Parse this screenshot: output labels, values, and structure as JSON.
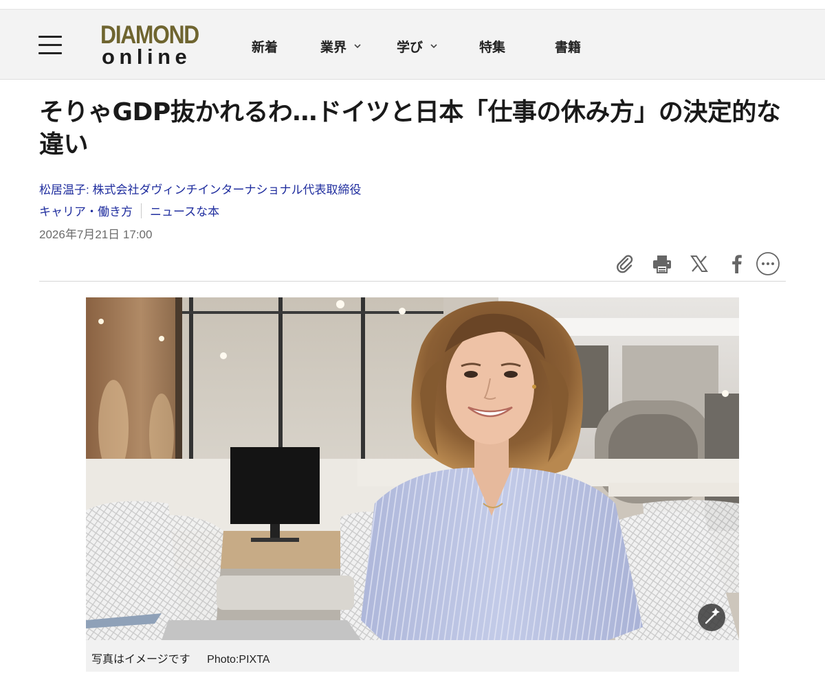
{
  "header": {
    "logo_top": "DIAMOND",
    "logo_bottom": "online",
    "nav": [
      {
        "label": "新着",
        "dropdown": false
      },
      {
        "label": "業界",
        "dropdown": true
      },
      {
        "label": "学び",
        "dropdown": true
      },
      {
        "label": "特集",
        "dropdown": false
      },
      {
        "label": "書籍",
        "dropdown": false
      }
    ]
  },
  "article": {
    "title": "そりゃGDP抜かれるわ…ドイツと日本「仕事の休み方」の決定的な違い",
    "author": "松居温子: 株式会社ダヴィンチインターナショナル代表取締役",
    "categories": [
      "キャリア・働き方",
      "ニュースな本"
    ],
    "date": "2026年7月21日 17:00"
  },
  "share_icons": [
    "clip-icon",
    "print-icon",
    "x-icon",
    "facebook-icon",
    "more-icon"
  ],
  "image": {
    "caption": "写真はイメージです",
    "credit": "Photo:PIXTA"
  },
  "colors": {
    "logo_gold": "#6f6530",
    "link_blue": "#1f2d9e",
    "header_bg": "#f3f3f3"
  }
}
